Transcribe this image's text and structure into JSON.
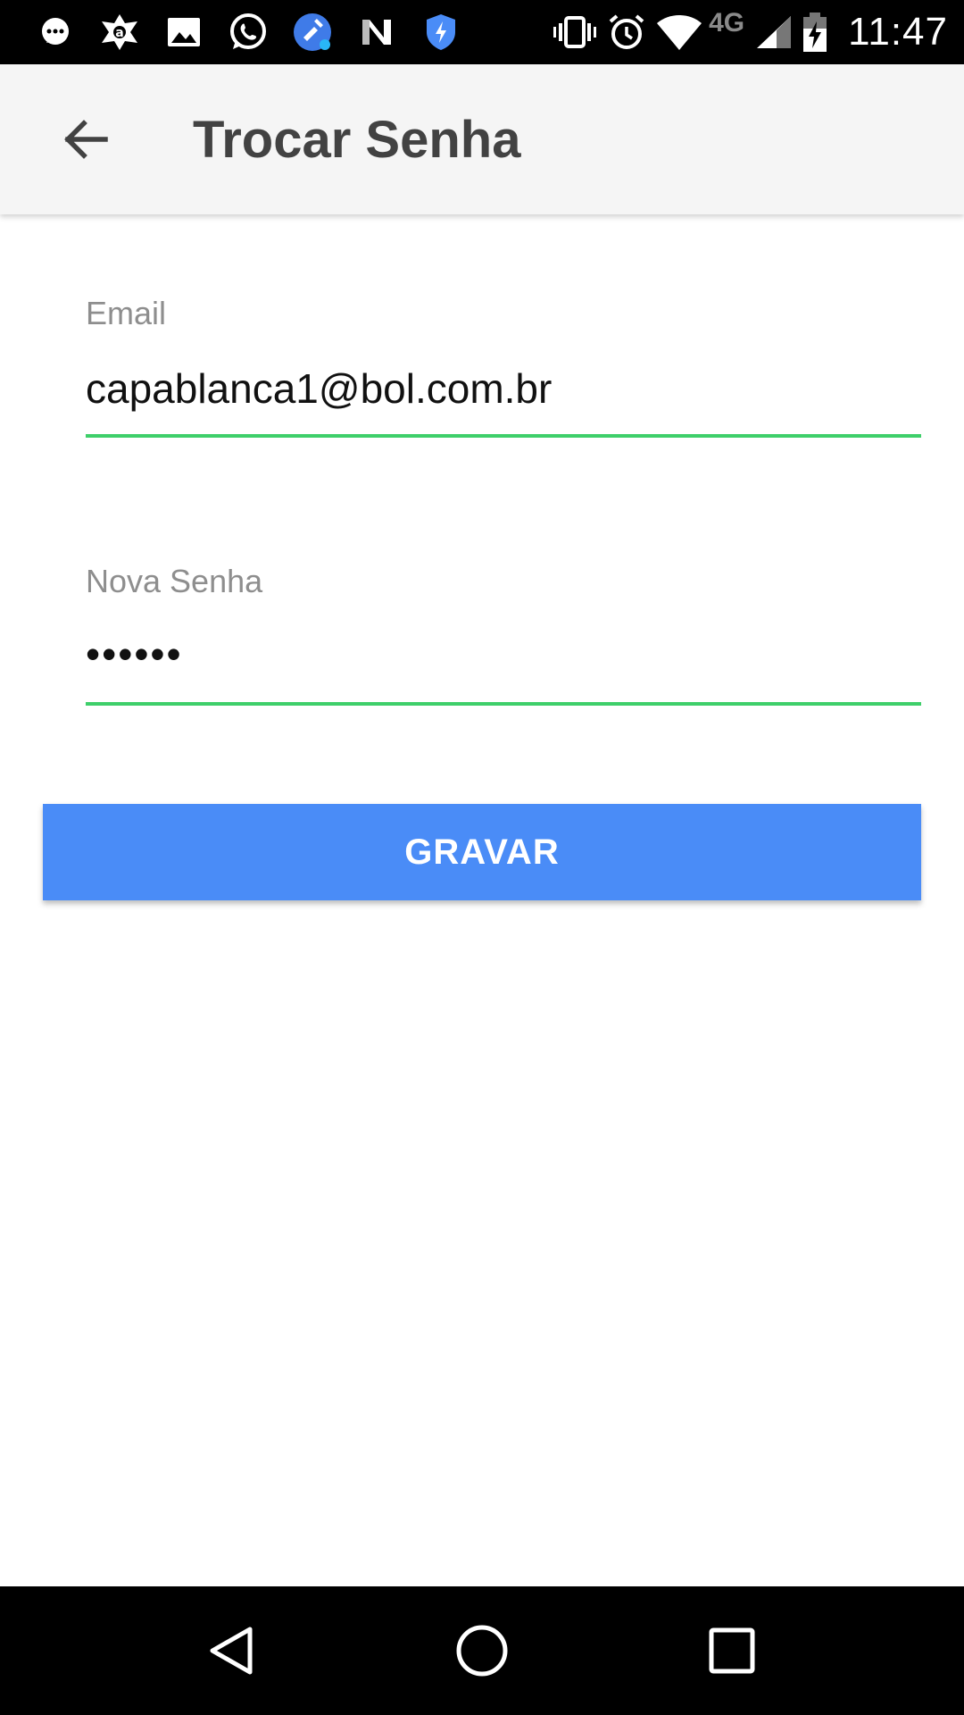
{
  "status_bar": {
    "icons": [
      "chat-bubble-icon",
      "avast-icon",
      "image-icon",
      "whatsapp-icon",
      "cleaner-icon",
      "n-icon",
      "shield-icon",
      "vibrate-icon",
      "alarm-icon",
      "wifi-icon",
      "signal-icon",
      "battery-charging-icon"
    ],
    "network": "4G",
    "time": "11:47"
  },
  "app_bar": {
    "title": "Trocar Senha",
    "back_icon": "arrow-back-icon"
  },
  "form": {
    "email": {
      "label": "Email",
      "value": "capablanca1@bol.com.br"
    },
    "password": {
      "label": "Nova Senha",
      "masked_value": "••••••"
    },
    "submit_label": "GRAVAR"
  },
  "nav_bar": {
    "icons": [
      "back-triangle-icon",
      "home-circle-icon",
      "recents-square-icon"
    ]
  },
  "colors": {
    "accent": "#4a8cf7",
    "field_underline": "#3ecf6a",
    "app_bar_bg": "#f5f5f5",
    "title": "#424242",
    "label": "#8e8e8e"
  }
}
